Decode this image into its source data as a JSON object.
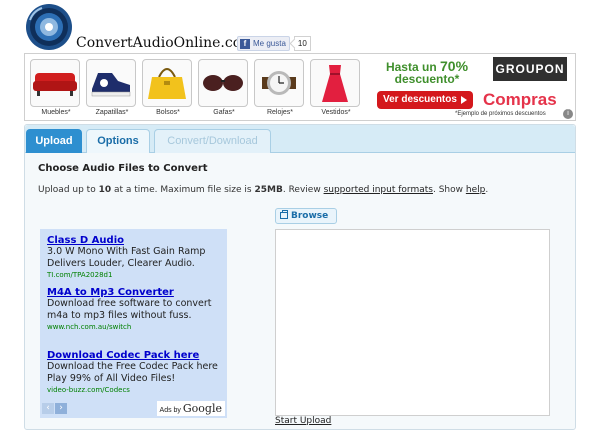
{
  "site": {
    "name": "ConvertAudioOnline.com",
    "like_label": "Me gusta",
    "like_count": "10"
  },
  "banner": {
    "products": [
      {
        "label": "Muebles*",
        "icon": "sofa-icon"
      },
      {
        "label": "Zapatillas*",
        "icon": "sneaker-icon"
      },
      {
        "label": "Bolsos*",
        "icon": "handbag-icon"
      },
      {
        "label": "Gafas*",
        "icon": "sunglasses-icon"
      },
      {
        "label": "Relojes*",
        "icon": "watch-icon"
      },
      {
        "label": "Vestidos*",
        "icon": "dress-icon"
      }
    ],
    "promo_prefix": "Hasta un",
    "promo_pct": "70%",
    "promo_line2": "descuento*",
    "cta": "Ver descuentos",
    "brand": "GROUPON",
    "compras": "Compras",
    "disclaimer": "*Ejemplo de próximos descuentos",
    "colors": {
      "green": "#3f8f2c",
      "red": "#d4181c",
      "pink": "#e5334a"
    }
  },
  "tabs": [
    {
      "label": "Upload",
      "state": "active"
    },
    {
      "label": "Options",
      "state": "enabled"
    },
    {
      "label": "Convert/Download",
      "state": "disabled"
    }
  ],
  "upload": {
    "title": "Choose Audio Files to Convert",
    "info_1": "Upload up to",
    "max_files": "10",
    "info_2": "at a time. Maximum file size is",
    "max_size": "25MB",
    "info_3": ". Review",
    "formats_link": "supported input formats",
    "info_4": ". Show",
    "help_link": "help",
    "info_5": ".",
    "browse_label": "Browse",
    "start_label": "Start Upload"
  },
  "ads": {
    "items": [
      {
        "title": "Class D Audio",
        "text": "3.0 W Mono With Fast Gain Ramp Delivers Louder, Clearer Audio.",
        "url": "TI.com/TPA2028d1"
      },
      {
        "title": "M4A to Mp3 Converter",
        "text": "Download free software to convert m4a to mp3 files without fuss.",
        "url": "www.nch.com.au/switch"
      },
      {
        "title": "Download Codec Pack here",
        "text": "Download the Free Codec Pack here Play 99% of All Video Files!",
        "url": "video-buzz.com/Codecs"
      }
    ],
    "ads_by": "Ads by",
    "google": "Google"
  }
}
